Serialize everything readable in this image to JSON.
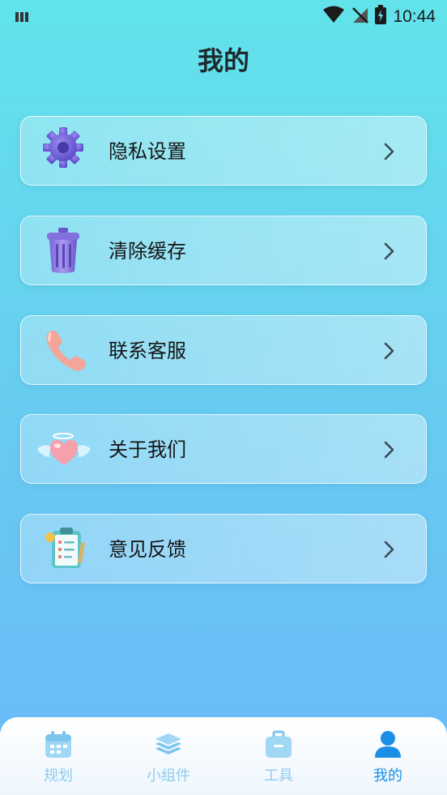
{
  "status_bar": {
    "time": "10:44"
  },
  "header": {
    "title": "我的"
  },
  "menu": {
    "items": [
      {
        "label": "隐私设置",
        "icon": "gear-icon"
      },
      {
        "label": "清除缓存",
        "icon": "trash-icon"
      },
      {
        "label": "联系客服",
        "icon": "phone-icon"
      },
      {
        "label": "关于我们",
        "icon": "winged-heart-icon"
      },
      {
        "label": "意见反馈",
        "icon": "clipboard-icon"
      }
    ]
  },
  "tab_bar": {
    "tabs": [
      {
        "label": "规划",
        "icon": "calendar-icon",
        "active": false
      },
      {
        "label": "小组件",
        "icon": "layers-icon",
        "active": false
      },
      {
        "label": "工具",
        "icon": "toolbox-icon",
        "active": false
      },
      {
        "label": "我的",
        "icon": "user-icon",
        "active": true
      }
    ]
  },
  "colors": {
    "accent": "#1a8fe6",
    "tab_inactive": "#8fcbef"
  }
}
